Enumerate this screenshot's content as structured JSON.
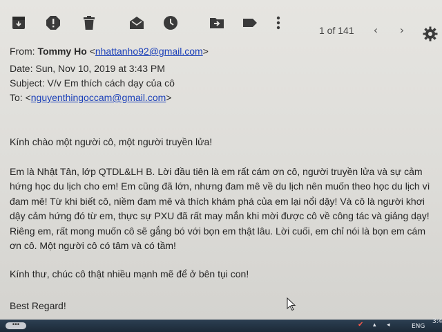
{
  "toolbar": {
    "icons": [
      "archive-icon",
      "report-spam-icon",
      "delete-icon",
      "mark-unread-icon",
      "snooze-icon",
      "move-to-icon",
      "labels-icon",
      "more-icon"
    ],
    "pager_text": "1 of 141",
    "prev_glyph": "‹",
    "next_glyph": "›",
    "settings_icon": "gear-icon"
  },
  "header": {
    "from_label": "From:",
    "from_name": "Tommy Ho",
    "from_email": "nhattanho92@gmail.com",
    "date_label": "Date:",
    "date_value": "Sun, Nov 10, 2019 at 3:43 PM",
    "subject_label": "Subject:",
    "subject_value": "V/v Em thích cách dạy của cô",
    "to_label": "To:",
    "to_email": "nguyenthingoccam@gmail.com"
  },
  "body": {
    "greeting": "Kính chào một người cô, một người truyền lửa!",
    "para_lines": [
      "Em là Nhật Tân, lớp QTDL&LH B. Lời đầu tiên là em rất cám ơn cô, người truyền lửa và sự cảm",
      "hứng học du lịch cho em! Em cũng đã lớn, nhưng đam mê về du lịch nên muốn theo học du lịch vì",
      "đam mê! Từ khi biết cô, niềm đam mê và thích khám phá của em lại nổi dậy! Và cô là người khơi",
      "dậy cảm hứng đó từ em, thực sự PXU đã rất may mắn khi mời được cô về công tác và giảng dạy!",
      "Riêng em, rất mong muốn cô sẽ gắng bó với bọn em thật lâu. Lời cuối, em chỉ nói là bọn em cám",
      "ơn cô. Một người cô có tâm và có tầm!"
    ],
    "closing": "Kính thư, chúc cô thật nhiều mạnh mẽ để ở bên tụi con!",
    "signature": "Best Regard!"
  },
  "taskbar": {
    "dots": "•••",
    "language": "ENG",
    "clock_partial": "3:4"
  }
}
